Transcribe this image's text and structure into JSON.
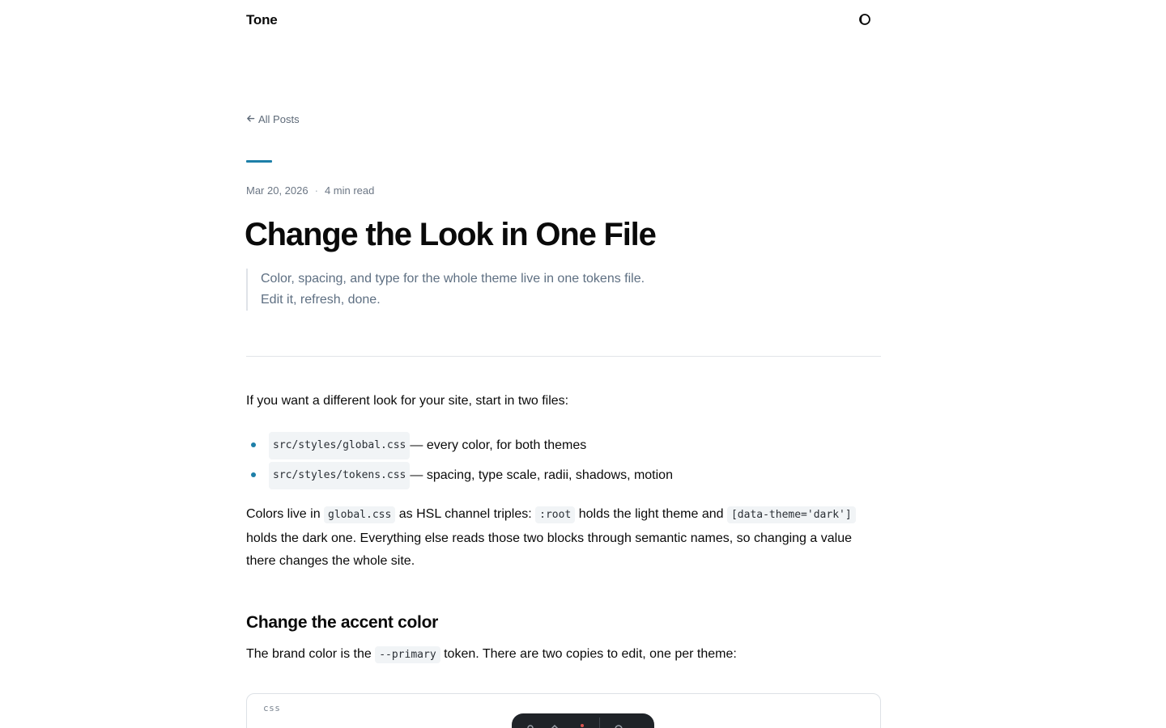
{
  "header": {
    "logo": "Tone",
    "theme_toggle_icon": "half-moon-icon"
  },
  "nav": {
    "back_label": "All Posts",
    "back_icon": "arrow-left-icon"
  },
  "post": {
    "date": "Mar 20, 2026",
    "separator": "·",
    "read_time": "4 min read",
    "title": "Change the Look in One File",
    "lede_line1": "Color, spacing, and type for the whole theme live in one tokens file.",
    "lede_line2": "Edit it, refresh, done."
  },
  "body": {
    "intro": "If you want a different look for your site, start in two files:",
    "list": [
      {
        "code": "src/styles/global.css",
        "text": " — every color, for both themes"
      },
      {
        "code": "src/styles/tokens.css",
        "text": " — spacing, type scale, radii, shadows, motion"
      }
    ],
    "p2": {
      "t1": "Colors live in ",
      "c1": "global.css",
      "t2": " as HSL channel triples: ",
      "c2": ":root",
      "t3": " holds the light theme and ",
      "c3": "[data-theme='dark']",
      "t4": " holds the dark one. Everything else reads those two blocks through semantic names, so changing a value there changes the whole site."
    },
    "heading_accent": "Change the accent color",
    "p3": {
      "t1": "The brand color is the ",
      "c1": "--primary",
      "t2": " token. There are two copies to edit, one per theme:"
    },
    "codeblock_lang": "css"
  },
  "colors": {
    "accent": "#1d7fa8",
    "muted_text": "#5e6f82",
    "code_bg": "#f1f4f6"
  }
}
